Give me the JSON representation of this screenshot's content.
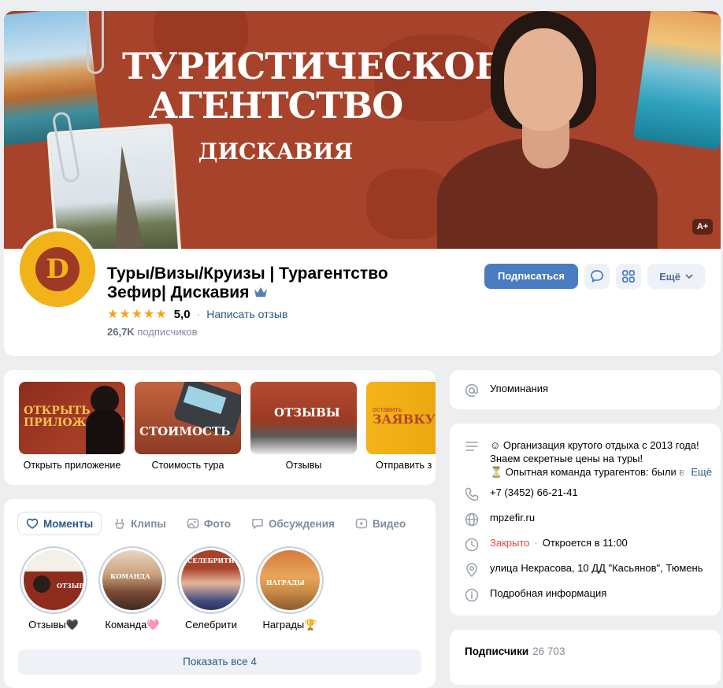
{
  "header": {
    "cover_title_line1": "ТУРИСТИЧЕСКОЕ",
    "cover_title_line2": "АГЕНТСТВО",
    "cover_brand": "ДИСКАВИЯ",
    "cover_badge": "A+",
    "avatar_letter": "D",
    "group_name": "Туры/Визы/Круизы | Турагентство Зефир| Дискавия",
    "rating_stars": "★★★★★",
    "rating_value": "5,0",
    "write_review": "Написать отзыв",
    "subscribers_count": "26,7K",
    "subscribers_label": "подписчиков",
    "subscribe_button": "Подписаться",
    "more_button": "Ещё",
    "colors": {
      "accent": "#4a7cc1",
      "cover": "#a8432b",
      "avatar": "#f2b21a"
    }
  },
  "apps": [
    {
      "label": "Открыть приложение",
      "thumb_text": "ОТКРЫТЬ ПРИЛОЖЕНИЕ"
    },
    {
      "label": "Стоимость тура",
      "thumb_text": "СТОИМОСТЬ"
    },
    {
      "label": "Отзывы",
      "thumb_text": "ОТЗЫВЫ"
    },
    {
      "label": "Отправить з",
      "thumb_text": "ЗАЯВКУ",
      "thumb_text_small": "оставить"
    }
  ],
  "tabs": [
    {
      "label": "Моменты",
      "icon": "heart-icon",
      "active": true
    },
    {
      "label": "Клипы",
      "icon": "clips-icon"
    },
    {
      "label": "Фото",
      "icon": "photo-icon"
    },
    {
      "label": "Обсуждения",
      "icon": "discussion-icon"
    },
    {
      "label": "Видео",
      "icon": "video-icon"
    }
  ],
  "moments": [
    {
      "label": "Отзывы🖤",
      "thumb_text": "ОТЗЫВЫ"
    },
    {
      "label": "Команда🩷",
      "thumb_text": "КОМАНДА"
    },
    {
      "label": "Селебрити",
      "thumb_text": "СЕЛЕБРИТИ"
    },
    {
      "label": "Награды🏆",
      "thumb_text": "НАГРАДЫ"
    }
  ],
  "show_all": "Показать все 4",
  "mentions": {
    "label": "Упоминания"
  },
  "info": {
    "description_line1": "☺ Организация крутого отдыха с 2013 года!",
    "description_line2": "Знаем секретные цены на туры!",
    "description_line3": "⏳ Опытная команда турагентов: были в",
    "description_more": "Ещё",
    "phone": "+7 (3452) 66-21-41",
    "website": "mpzefir.ru",
    "status_closed": "Закрыто",
    "status_opens": "Откроется в 11:00",
    "address": "улица Некрасова, 10 ДД \"Касьянов\", Тюмень",
    "details": "Подробная информация"
  },
  "subscribers_block": {
    "title": "Подписчики",
    "count": "26 703"
  }
}
